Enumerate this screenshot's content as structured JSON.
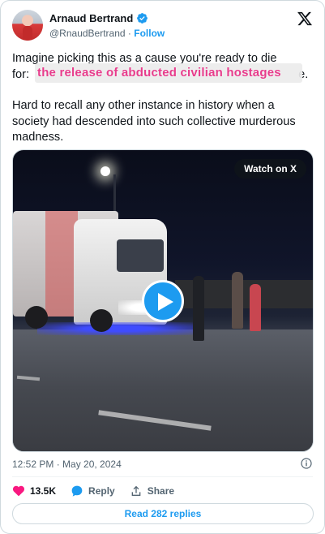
{
  "author": {
    "name": "Arnaud Bertrand",
    "handle": "@RnaudBertrand",
    "separator": "·",
    "follow_label": "Follow"
  },
  "tweet": {
    "paragraph1_start": "Imagine picking this as a cause you're ready to die",
    "paragraph1_end_prefix": "for:",
    "paragraph1_tail": "e.",
    "overlay_caption": "the release of abducted civilian hostages",
    "paragraph2": "Hard to recall any other instance in history when a society had descended into such collective murderous madness."
  },
  "media": {
    "watch_label": "Watch on X",
    "play_icon": "play-icon"
  },
  "meta": {
    "timestamp": "12:52 PM · May 20, 2024",
    "info_icon": "info-icon"
  },
  "actions": {
    "like_count": "13.5K",
    "reply_label": "Reply",
    "share_label": "Share"
  },
  "footer": {
    "read_replies": "Read 282 replies"
  },
  "colors": {
    "accent": "#1d9bf0",
    "heart": "#f91880",
    "overlay_text": "#e83c8c"
  }
}
